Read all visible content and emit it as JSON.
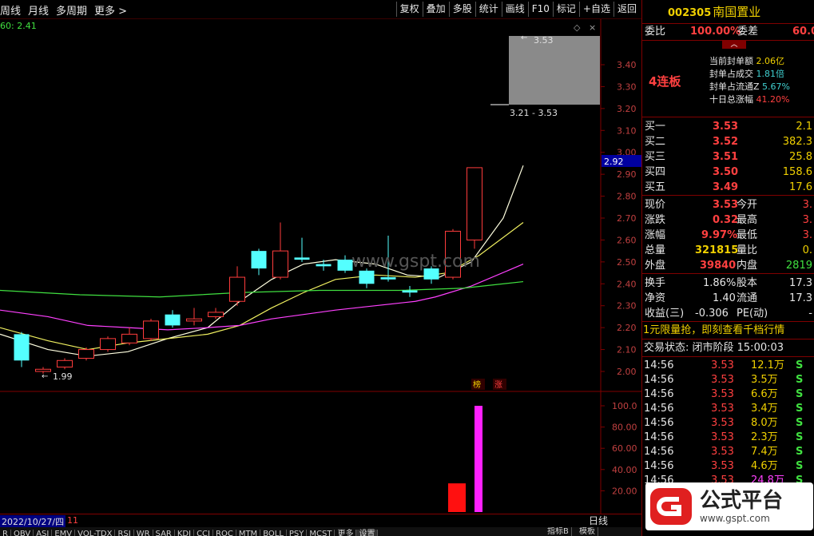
{
  "toolbar": {
    "left_items": [
      "周线",
      "月线",
      "多周期",
      "更多 >"
    ],
    "right_items": [
      "复权",
      "叠加",
      "多股",
      "统计",
      "画线",
      "F10",
      "标记",
      "+自选",
      "返回"
    ]
  },
  "ma_label": "60: 2.41",
  "price_axis": [
    "3.40",
    "3.30",
    "3.20",
    "3.10",
    "3.00",
    "2.90",
    "2.80",
    "2.70",
    "2.60",
    "2.50",
    "2.40",
    "2.30",
    "2.20",
    "2.10",
    "2.00"
  ],
  "current_price_tag": "2.92",
  "range_box": {
    "high_label": "3.53",
    "range_label": "3.21 - 3.53"
  },
  "low_label": "1.99",
  "watermark": "www.gspt.com",
  "tags": {
    "bang": "榜",
    "zhang": "涨"
  },
  "volume_axis": [
    "100.0",
    "80.00",
    "60.00",
    "40.00",
    "20.00"
  ],
  "date_bar": {
    "date": "2022/10/27/四",
    "value": "11",
    "chart_label": "日线"
  },
  "bottom_tabs": [
    "R",
    "OBV",
    "ASI",
    "EMV",
    "VOL-TDX",
    "RSI",
    "WR",
    "SAR",
    "KDJ",
    "CCI",
    "ROC",
    "MTM",
    "BOLL",
    "PSY",
    "MCST",
    "更多",
    "设置"
  ],
  "bottom_right": [
    "指标B",
    "模板"
  ],
  "chart_data": {
    "type": "candlestick",
    "candles": [
      {
        "o": 2.17,
        "c": 2.05,
        "h": 2.18,
        "l": 2.02,
        "color": "cyan"
      },
      {
        "o": 2.0,
        "c": 2.01,
        "h": 2.02,
        "l": 1.99,
        "color": "red"
      },
      {
        "o": 2.02,
        "c": 2.05,
        "h": 2.06,
        "l": 2.01,
        "color": "red"
      },
      {
        "o": 2.06,
        "c": 2.1,
        "h": 2.11,
        "l": 2.05,
        "color": "red"
      },
      {
        "o": 2.1,
        "c": 2.15,
        "h": 2.16,
        "l": 2.09,
        "color": "red"
      },
      {
        "o": 2.13,
        "c": 2.17,
        "h": 2.2,
        "l": 2.12,
        "color": "red"
      },
      {
        "o": 2.15,
        "c": 2.23,
        "h": 2.24,
        "l": 2.14,
        "color": "red"
      },
      {
        "o": 2.26,
        "c": 2.21,
        "h": 2.28,
        "l": 2.2,
        "color": "cyan"
      },
      {
        "o": 2.23,
        "c": 2.24,
        "h": 2.29,
        "l": 2.21,
        "color": "red"
      },
      {
        "o": 2.25,
        "c": 2.27,
        "h": 2.29,
        "l": 2.24,
        "color": "red"
      },
      {
        "o": 2.32,
        "c": 2.43,
        "h": 2.48,
        "l": 2.3,
        "color": "red"
      },
      {
        "o": 2.55,
        "c": 2.47,
        "h": 2.56,
        "l": 2.44,
        "color": "cyan"
      },
      {
        "o": 2.43,
        "c": 2.55,
        "h": 2.68,
        "l": 2.42,
        "color": "red"
      },
      {
        "o": 2.51,
        "c": 2.52,
        "h": 2.61,
        "l": 2.5,
        "color": "cyan"
      },
      {
        "o": 2.48,
        "c": 2.49,
        "h": 2.51,
        "l": 2.46,
        "color": "cyan"
      },
      {
        "o": 2.51,
        "c": 2.46,
        "h": 2.53,
        "l": 2.45,
        "color": "cyan"
      },
      {
        "o": 2.46,
        "c": 2.4,
        "h": 2.47,
        "l": 2.38,
        "color": "cyan"
      },
      {
        "o": 2.43,
        "c": 2.42,
        "h": 2.62,
        "l": 2.41,
        "color": "cyan"
      },
      {
        "o": 2.37,
        "c": 2.36,
        "h": 2.39,
        "l": 2.34,
        "color": "cyan"
      },
      {
        "o": 2.47,
        "c": 2.42,
        "h": 2.48,
        "l": 2.4,
        "color": "cyan"
      },
      {
        "o": 2.43,
        "c": 2.64,
        "h": 2.65,
        "l": 2.42,
        "color": "red"
      },
      {
        "o": 2.6,
        "c": 2.93,
        "h": 2.93,
        "l": 2.56,
        "color": "red"
      }
    ],
    "volume": [
      {
        "value": 27,
        "color": "red"
      },
      {
        "value": 100,
        "color": "magenta"
      }
    ]
  },
  "quote": {
    "code": "002305",
    "name": "南国置业",
    "weibi_label": "委比",
    "weibi_value": "100.00%",
    "weicha_label": "委差",
    "weicha_value": "60.0",
    "board_label": "4连板",
    "seal_stats": [
      {
        "label": "当前封单额",
        "value": "2.06亿"
      },
      {
        "label": "封单占成交",
        "value": "1.81倍"
      },
      {
        "label": "封单占流通Z",
        "value": "5.67%"
      },
      {
        "label": "十日总涨幅",
        "value": "41.20%"
      }
    ],
    "bids": [
      {
        "label": "买一",
        "price": "3.53",
        "vol": "2.1"
      },
      {
        "label": "买二",
        "price": "3.52",
        "vol": "382.3"
      },
      {
        "label": "买三",
        "price": "3.51",
        "vol": "25.8"
      },
      {
        "label": "买四",
        "price": "3.50",
        "vol": "158.6"
      },
      {
        "label": "买五",
        "price": "3.49",
        "vol": "17.6"
      }
    ],
    "stats_left": [
      {
        "label": "现价",
        "value": "3.53"
      },
      {
        "label": "涨跌",
        "value": "0.32"
      },
      {
        "label": "涨幅",
        "value": "9.97%"
      },
      {
        "label": "总量",
        "value": "321815"
      },
      {
        "label": "外盘",
        "value": "39840"
      }
    ],
    "stats_right": [
      {
        "label": "今开",
        "value": "3."
      },
      {
        "label": "最高",
        "value": "3."
      },
      {
        "label": "最低",
        "value": "3."
      },
      {
        "label": "量比",
        "value": "0."
      },
      {
        "label": "内盘",
        "value": "2819"
      }
    ],
    "stats2": [
      {
        "label": "换手",
        "value": "1.86%",
        "label2": "股本",
        "value2": "17.3"
      },
      {
        "label": "净资",
        "value": "1.40",
        "label2": "流通",
        "value2": "17.3"
      },
      {
        "label": "收益(三)",
        "value": "-0.306",
        "label2": "PE(动)",
        "value2": "-"
      }
    ],
    "promo": "1元限量抢，即刻查看千档行情",
    "trade_status": "交易状态: 闭市阶段 15:00:03",
    "ticks": [
      {
        "time": "14:56",
        "price": "3.53",
        "vol": "12.1万",
        "side": "S"
      },
      {
        "time": "14:56",
        "price": "3.53",
        "vol": "3.5万",
        "side": "S"
      },
      {
        "time": "14:56",
        "price": "3.53",
        "vol": "6.6万",
        "side": "S"
      },
      {
        "time": "14:56",
        "price": "3.53",
        "vol": "3.4万",
        "side": "S"
      },
      {
        "time": "14:56",
        "price": "3.53",
        "vol": "8.0万",
        "side": "S"
      },
      {
        "time": "14:56",
        "price": "3.53",
        "vol": "2.3万",
        "side": "S"
      },
      {
        "time": "14:56",
        "price": "3.53",
        "vol": "7.4万",
        "side": "S"
      },
      {
        "time": "14:56",
        "price": "3.53",
        "vol": "4.6万",
        "side": "S"
      },
      {
        "time": "14:56",
        "price": "3.53",
        "vol": "24.8万",
        "side": "S"
      }
    ]
  },
  "logo_text": "公式平台",
  "logo_url": "www.gspt.com"
}
